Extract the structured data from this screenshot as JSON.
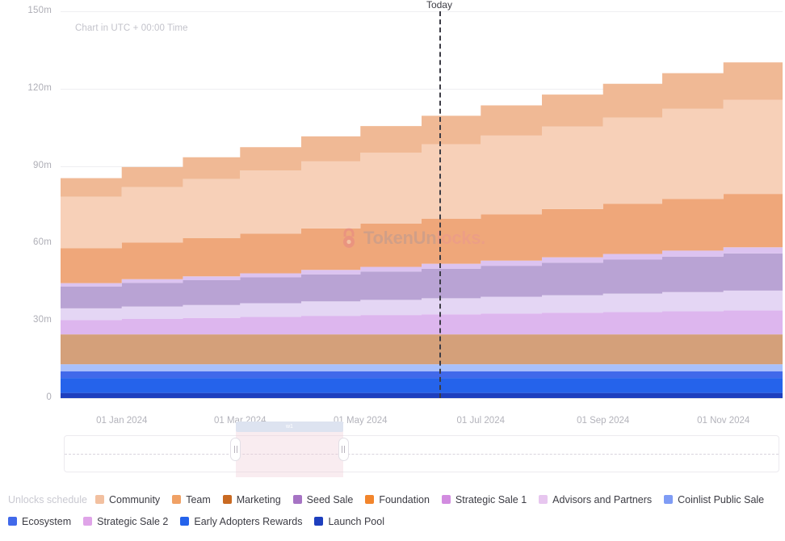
{
  "annotations": {
    "utc_note": "Chart in UTC + 00:00 Time",
    "today_label": "Today",
    "watermark_token": "TokenUn",
    "watermark_unlocks": "locks",
    "watermark_dot": ".",
    "range_tooltip": "w1"
  },
  "legend": {
    "title": "Unlocks schedule",
    "row1": [
      {
        "label": "Community",
        "color": "#f2c0a0"
      },
      {
        "label": "Team",
        "color": "#f0a165"
      },
      {
        "label": "Marketing",
        "color": "#c96a22"
      },
      {
        "label": "Seed Sale",
        "color": "#a673c4"
      },
      {
        "label": "Foundation",
        "color": "#f2852c"
      },
      {
        "label": "Strategic Sale 1",
        "color": "#d28ce0"
      },
      {
        "label": "Advisors and Partners",
        "color": "#e7c6ef"
      },
      {
        "label": "Coinlist Public Sale",
        "color": "#7f9cf5"
      }
    ],
    "row2": [
      {
        "label": "Ecosystem",
        "color": "#4169ea"
      },
      {
        "label": "Strategic Sale 2",
        "color": "#dfa4e8"
      },
      {
        "label": "Early Adopters Rewards",
        "color": "#2563eb"
      },
      {
        "label": "Launch Pool",
        "color": "#1e3fbe"
      }
    ]
  },
  "chart_data": {
    "type": "area",
    "title": "",
    "subtitle": "Chart in UTC + 00:00 Time",
    "stacked": true,
    "step": "post",
    "xlabel": "",
    "ylabel": "",
    "ylim": [
      0,
      150000000
    ],
    "yticks": [
      0,
      30000000,
      60000000,
      90000000,
      120000000,
      150000000
    ],
    "ytick_labels": [
      "0",
      "30m",
      "60m",
      "90m",
      "120m",
      "150m"
    ],
    "grid": true,
    "legend_position": "bottom",
    "x_start": "2023-12-01",
    "x_end": "2024-12-01",
    "xticks": [
      "2024-01-01",
      "2024-03-01",
      "2024-05-01",
      "2024-07-01",
      "2024-09-01",
      "2024-11-01"
    ],
    "xtick_labels": [
      "01 Jan 2024",
      "01 Mar 2024",
      "01 May 2024",
      "01 Jul 2024",
      "01 Sep 2024",
      "01 Nov 2024"
    ],
    "today_marker": "2024-06-10",
    "x": [
      "2023-12-01",
      "2024-01-01",
      "2024-02-01",
      "2024-03-01",
      "2024-04-01",
      "2024-05-01",
      "2024-06-01",
      "2024-07-01",
      "2024-08-01",
      "2024-09-01",
      "2024-10-01",
      "2024-11-01",
      "2024-12-01"
    ],
    "series": [
      {
        "name": "Launch Pool",
        "color": "#1e3fbe",
        "values": [
          2000000,
          2000000,
          2000000,
          2000000,
          2000000,
          2000000,
          2000000,
          2000000,
          2000000,
          2000000,
          2000000,
          2000000,
          2000000
        ]
      },
      {
        "name": "Early Adopters Rewards",
        "color": "#2563eb",
        "values": [
          5800000,
          5800000,
          5800000,
          5800000,
          5800000,
          5800000,
          5800000,
          5800000,
          5800000,
          5800000,
          5800000,
          5800000,
          5800000
        ]
      },
      {
        "name": "Ecosystem",
        "color": "#4169ea",
        "values": [
          2600000,
          2600000,
          2600000,
          2600000,
          2600000,
          2600000,
          2600000,
          2600000,
          2600000,
          2600000,
          2600000,
          2600000,
          2600000
        ]
      },
      {
        "name": "Coinlist Public Sale",
        "color": "#a9c0fb",
        "values": [
          2700000,
          2700000,
          2700000,
          2700000,
          2700000,
          2700000,
          2700000,
          2700000,
          2700000,
          2700000,
          2700000,
          2700000,
          2700000
        ]
      },
      {
        "name": "Marketing",
        "color": "#d4a07a",
        "values": [
          11600000,
          11600000,
          11600000,
          11600000,
          11600000,
          11600000,
          11600000,
          11600000,
          11600000,
          11600000,
          11600000,
          11600000,
          11600000
        ]
      },
      {
        "name": "Strategic Sale 2",
        "color": "#ddb6ee",
        "values": [
          5600000,
          6000000,
          6400000,
          6800000,
          7200000,
          7500000,
          7800000,
          8100000,
          8400000,
          8700000,
          9000000,
          9300000,
          9600000
        ]
      },
      {
        "name": "Advisors and Partners",
        "color": "#e4d6f4",
        "values": [
          4500000,
          4800000,
          5000000,
          5300000,
          5600000,
          5900000,
          6200000,
          6500000,
          6800000,
          7100000,
          7400000,
          7700000,
          8000000
        ]
      },
      {
        "name": "Seed Sale",
        "color": "#b9a3d4",
        "values": [
          8500000,
          9200000,
          9600000,
          10000000,
          10500000,
          11000000,
          11500000,
          12000000,
          12600000,
          13200000,
          13800000,
          14400000,
          15000000
        ]
      },
      {
        "name": "Strategic Sale 1",
        "color": "#dcc3f0",
        "values": [
          1300000,
          1400000,
          1500000,
          1600000,
          1700000,
          1800000,
          1900000,
          2000000,
          2100000,
          2200000,
          2300000,
          2400000,
          2500000
        ]
      },
      {
        "name": "Foundation",
        "color": "#efa77a",
        "values": [
          13500000,
          14200000,
          14800000,
          15400000,
          16100000,
          16800000,
          17400000,
          18000000,
          18700000,
          19400000,
          20000000,
          20700000,
          21300000
        ]
      },
      {
        "name": "Community",
        "color": "#f7d0b8",
        "values": [
          20000000,
          21500000,
          23000000,
          24500000,
          26000000,
          27500000,
          29000000,
          30500000,
          32000000,
          33500000,
          35000000,
          36500000,
          38000000
        ]
      },
      {
        "name": "Team",
        "color": "#f0b995",
        "values": [
          7200000,
          7800000,
          8400000,
          9000000,
          9700000,
          10300000,
          11000000,
          11700000,
          12400000,
          13100000,
          13800000,
          14500000,
          15200000
        ]
      }
    ],
    "totals": [
      85300000,
      89600000,
      93400000,
      97100000,
      101400000,
      105400000,
      109300000,
      113200000,
      117400000,
      121600000,
      125700000,
      130000000,
      134100000
    ]
  },
  "range_selector": {
    "selection_start_pct": 24.0,
    "selection_end_pct": 39.0
  }
}
